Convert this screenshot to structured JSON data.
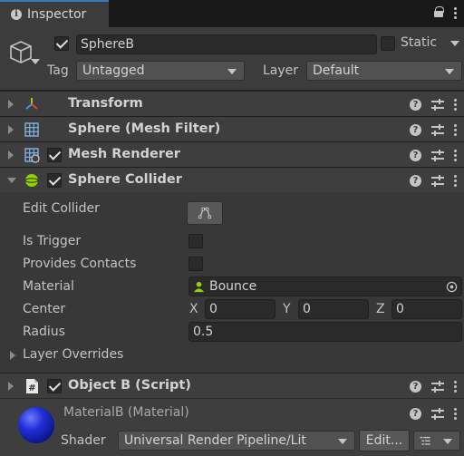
{
  "tab": {
    "title": "Inspector"
  },
  "header": {
    "object_name": "SphereB",
    "active": true,
    "static_label": "Static",
    "static": false,
    "tag_label": "Tag",
    "tag_value": "Untagged",
    "layer_label": "Layer",
    "layer_value": "Default"
  },
  "components": [
    {
      "title": "Transform",
      "icon": "transform-icon",
      "expanded": false,
      "has_checkbox": false
    },
    {
      "title": "Sphere (Mesh Filter)",
      "icon": "mesh-filter-icon",
      "expanded": false,
      "has_checkbox": false
    },
    {
      "title": "Mesh Renderer",
      "icon": "mesh-renderer-icon",
      "expanded": false,
      "has_checkbox": true,
      "enabled": true
    },
    {
      "title": "Sphere Collider",
      "icon": "sphere-collider-icon",
      "expanded": true,
      "has_checkbox": true,
      "enabled": true
    },
    {
      "title": "Object B (Script)",
      "icon": "script-icon",
      "expanded": false,
      "has_checkbox": true,
      "enabled": true
    }
  ],
  "collider": {
    "edit_collider_label": "Edit Collider",
    "is_trigger_label": "Is Trigger",
    "is_trigger": false,
    "provides_contacts_label": "Provides Contacts",
    "provides_contacts": false,
    "material_label": "Material",
    "material_value": "Bounce",
    "center_label": "Center",
    "center_x_label": "X",
    "center_x": "0",
    "center_y_label": "Y",
    "center_y": "0",
    "center_z_label": "Z",
    "center_z": "0",
    "radius_label": "Radius",
    "radius": "0.5",
    "layer_overrides_label": "Layer Overrides"
  },
  "material": {
    "title": "MaterialB (Material)",
    "shader_label": "Shader",
    "shader_value": "Universal Render Pipeline/Lit",
    "edit_button": "Edit..."
  },
  "colors": {
    "accent": "#3a79bb",
    "material_sphere": "#2030d8",
    "collider_icon": "#8fd400"
  }
}
